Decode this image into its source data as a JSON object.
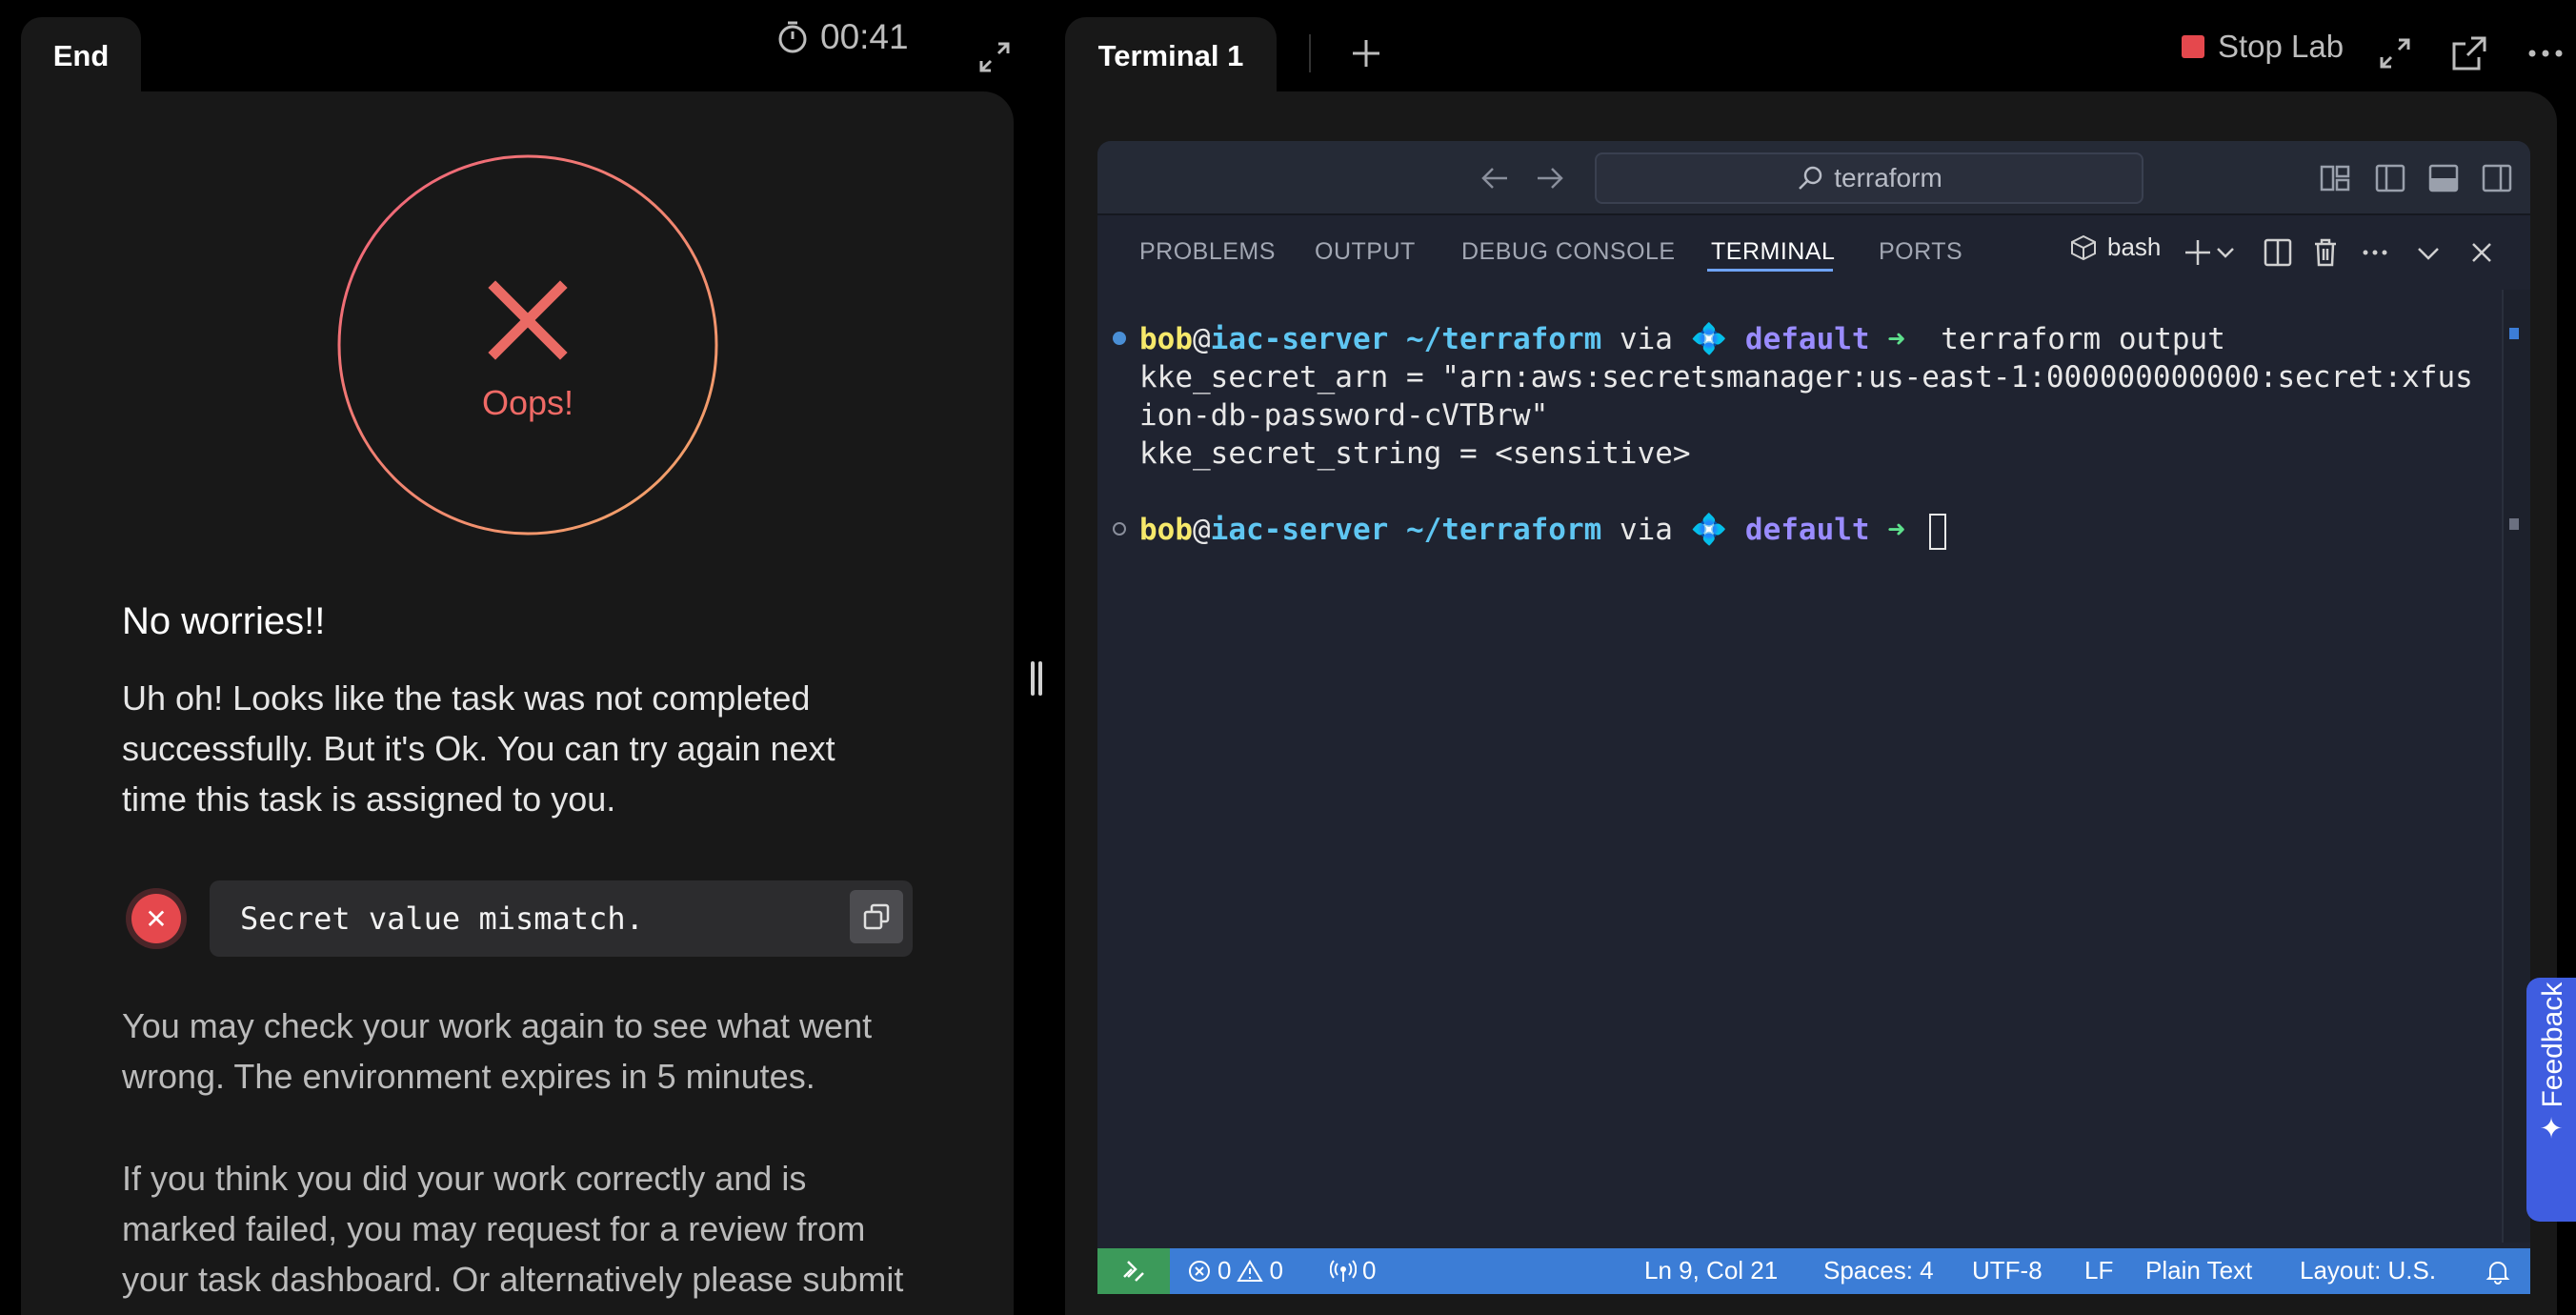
{
  "left": {
    "tab_label": "End",
    "timer": "00:41",
    "result_label": "Oops!",
    "heading": "No worries!!",
    "message_lines": [
      "Uh oh! Looks like the task was not completed",
      "successfully. But it's Ok. You can try again next",
      "time this task is assigned to you."
    ],
    "error_text": "Secret value mismatch.",
    "info_lines": [
      "You may check your work again to see what went",
      "wrong. The environment expires in 5 minutes."
    ],
    "review_lines": [
      "If you think you did your work correctly and is",
      "marked failed, you may request for a review from",
      "your task dashboard. Or alternatively please submit"
    ]
  },
  "right": {
    "tab_label": "Terminal 1",
    "stop_lab_label": "Stop Lab"
  },
  "vscode": {
    "search_text": "terraform",
    "panel_tabs": [
      "PROBLEMS",
      "OUTPUT",
      "DEBUG CONSOLE",
      "TERMINAL",
      "PORTS"
    ],
    "active_tab": "TERMINAL",
    "shell": "bash",
    "prompt": {
      "user": "bob",
      "at": "@",
      "host": "iac-server",
      "path": "~/terraform",
      "via": "via",
      "context_icon": "💠",
      "context": "default",
      "arrow": "➜"
    },
    "command": "terraform output",
    "output_lines": [
      "kke_secret_arn = \"arn:aws:secretsmanager:us-east-1:000000000000:secret:xfus",
      "ion-db-password-cVTBrw\"",
      "kke_secret_string = <sensitive>"
    ],
    "status": {
      "errors": "0",
      "warnings": "0",
      "ports": "0",
      "position": "Ln 9, Col 21",
      "spaces": "Spaces: 4",
      "encoding": "UTF-8",
      "eol": "LF",
      "language": "Plain Text",
      "layout": "Layout: U.S."
    }
  },
  "feedback_label": "✦ Feedback",
  "colors": {
    "error_red": "#e5484d",
    "oops_text": "#f06a66",
    "status_blue": "#3c7dd6",
    "remote_green": "#3c9a5a",
    "feedback_blue": "#3f5de0"
  }
}
